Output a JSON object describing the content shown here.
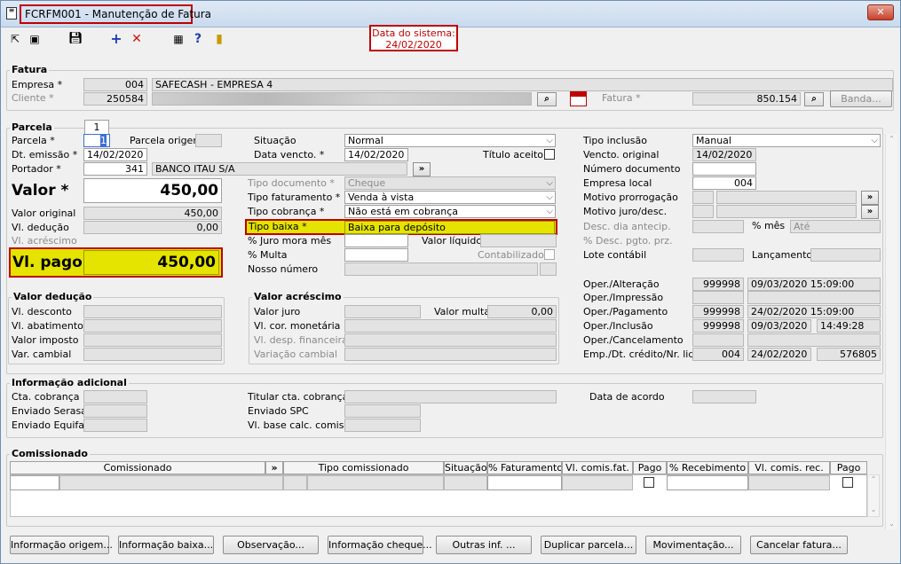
{
  "window": {
    "title": "FCRFM001 - Manutenção de Fatura",
    "close": "✕"
  },
  "system_date": {
    "line1": "Data do sistema:",
    "line2": "24/02/2020"
  },
  "fatura": {
    "section": "Fatura",
    "empresa_label": "Empresa *",
    "empresa_code": "004",
    "empresa_name": "SAFECASH -  EMPRESA 4",
    "cliente_label": "Cliente *",
    "cliente_code": "250584",
    "fatura_label": "Fatura *",
    "fatura_value": "850.154",
    "banda_label": "Banda..."
  },
  "parcela": {
    "section": "Parcela",
    "tab": "1",
    "parcela_label": "Parcela *",
    "parcela_value": "1",
    "origem_label": "Parcela origem",
    "emissao_label": "Dt. emissão *",
    "emissao_value": "14/02/2020",
    "portador_label": "Portador *",
    "portador_code": "341",
    "portador_name": "BANCO ITAU S/A",
    "valor_label": "Valor *",
    "valor_value": "450,00",
    "valor_original_label": "Valor original",
    "valor_original": "450,00",
    "vl_deducao_label": "Vl. dedução",
    "vl_deducao": "0,00",
    "vl_acrescimo_label": "Vl. acréscimo",
    "vl_pago_label": "Vl. pago",
    "vl_pago": "450,00"
  },
  "middle": {
    "situacao_label": "Situação",
    "situacao": "Normal",
    "vencto_label": "Data vencto. *",
    "vencto": "14/02/2020",
    "titulo_aceito": "Título aceito",
    "tipo_documento_label": "Tipo documento *",
    "tipo_documento": "Cheque",
    "tipo_fat_label": "Tipo faturamento *",
    "tipo_fat": "Venda à vista",
    "tipo_cob_label": "Tipo cobrança *",
    "tipo_cob": "Não está em cobrança",
    "tipo_baixa_label": "Tipo baixa *",
    "tipo_baixa": "Baixa para depósito",
    "juro_label": "% Juro mora mês",
    "valor_liquido_label": "Valor líquido",
    "multa_label": "% Multa",
    "contabilizado": "Contabilizado",
    "nosso_numero_label": "Nosso número"
  },
  "right": {
    "tipo_inclusao_label": "Tipo inclusão",
    "tipo_inclusao": "Manual",
    "vencto_original_label": "Vencto. original",
    "vencto_original": "14/02/2020",
    "numero_doc_label": "Número documento",
    "empresa_local_label": "Empresa local",
    "empresa_local": "004",
    "motivo_prorr_label": "Motivo prorrogação",
    "motivo_juro_label": "Motivo juro/desc.",
    "desc_antecip_label": "Desc. dia antecip.",
    "pct_mes": "% mês",
    "ate": "Até",
    "desc_pgto_label": "% Desc. pgto. prz.",
    "lote_label": "Lote contábil",
    "lancamento_label": "Lançamento"
  },
  "oper": {
    "alteracao_label": "Oper./Alteração",
    "alteracao_user": "999998",
    "alteracao_dt": "09/03/2020 15:09:00",
    "impressao_label": "Oper./Impressão",
    "pagamento_label": "Oper./Pagamento",
    "pagamento_user": "999998",
    "pagamento_dt": "24/02/2020 15:09:00",
    "inclusao_label": "Oper./Inclusão",
    "inclusao_user": "999998",
    "inclusao_date": "09/03/2020",
    "inclusao_time": "14:49:28",
    "cancelamento_label": "Oper./Cancelamento",
    "emp_label": "Emp./Dt. crédito/Nr. liq.",
    "emp_code": "004",
    "emp_dt": "24/02/2020",
    "emp_nr": "576805"
  },
  "deducao": {
    "section": "Valor dedução",
    "desconto": "Vl. desconto",
    "abatimento": "Vl. abatimento",
    "imposto": "Valor imposto",
    "cambial": "Var. cambial"
  },
  "acrescimo": {
    "section": "Valor acréscimo",
    "juro": "Valor juro",
    "multa_label": "Valor multa",
    "multa": "0,00",
    "correcao": "Vl. cor. monetária",
    "desp_fin": "Vl. desp. financeira",
    "variacao": "Variação cambial"
  },
  "info": {
    "section": "Informação adicional",
    "cta": "Cta. cobrança",
    "serasa": "Enviado Serasa",
    "equifax": "Enviado Equifax",
    "titular": "Titular cta. cobrança",
    "spc": "Enviado SPC",
    "base_calc": "Vl. base calc. comis.",
    "acordo": "Data de acordo"
  },
  "comis": {
    "section": "Comissionado",
    "headers": [
      "Comissionado",
      "»",
      "Tipo comissionado",
      "Situação",
      "% Faturamento",
      "Vl. comis.fat.",
      "Pago",
      "% Recebimento",
      "Vl. comis. rec.",
      "Pago"
    ]
  },
  "buttons": [
    "Informação origem...",
    "Informação baixa...",
    "Observação...",
    "Informação cheque...",
    "Outras inf. ...",
    "Duplicar parcela...",
    "Movimentação...",
    "Cancelar fatura..."
  ]
}
